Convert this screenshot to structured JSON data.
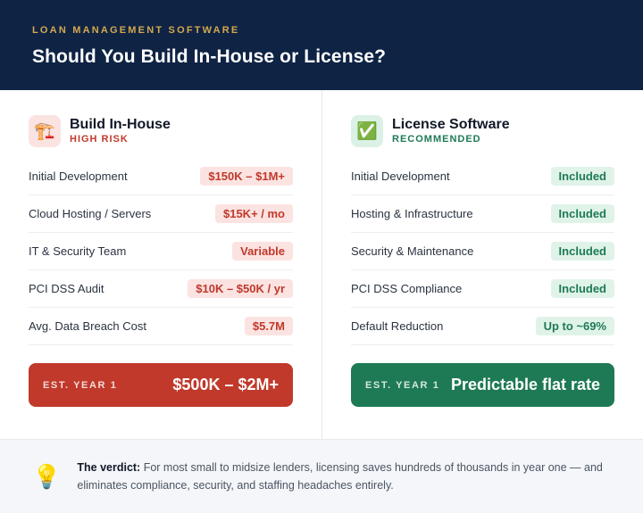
{
  "header": {
    "kicker": "LOAN MANAGEMENT SOFTWARE",
    "title": "Should You Build In-House or License?"
  },
  "build": {
    "icon": "construction-crane-icon",
    "icon_glyph": "🏗️",
    "title": "Build In-House",
    "tag": "HIGH RISK",
    "rows": [
      {
        "label": "Initial Development",
        "value": "$150K – $1M+"
      },
      {
        "label": "Cloud Hosting / Servers",
        "value": "$15K+ / mo"
      },
      {
        "label": "IT & Security Team",
        "value": "Variable"
      },
      {
        "label": "PCI DSS Audit",
        "value": "$10K – $50K / yr"
      },
      {
        "label": "Avg. Data Breach Cost",
        "value": "$5.7M"
      }
    ],
    "total_label": "EST. YEAR 1",
    "total_value": "$500K – $2M+",
    "accent": "#c0392b"
  },
  "license": {
    "icon": "check-mark-icon",
    "icon_glyph": "✅",
    "title": "License Software",
    "tag": "RECOMMENDED",
    "rows": [
      {
        "label": "Initial Development",
        "value": "Included"
      },
      {
        "label": "Hosting & Infrastructure",
        "value": "Included"
      },
      {
        "label": "Security & Maintenance",
        "value": "Included"
      },
      {
        "label": "PCI DSS Compliance",
        "value": "Included"
      },
      {
        "label": "Default Reduction",
        "value": "Up to ~69%"
      }
    ],
    "total_label": "EST. YEAR 1",
    "total_value": "Predictable flat rate",
    "accent": "#1e7a55"
  },
  "verdict": {
    "icon": "light-bulb-icon",
    "icon_glyph": "💡",
    "lead": "The verdict:",
    "text": " For most small to midsize lenders, licensing saves hundreds of thousands in year one — and eliminates compliance, security, and staffing headaches entirely."
  },
  "colors": {
    "header_bg": "#0f2344",
    "kicker": "#d4a94e"
  }
}
